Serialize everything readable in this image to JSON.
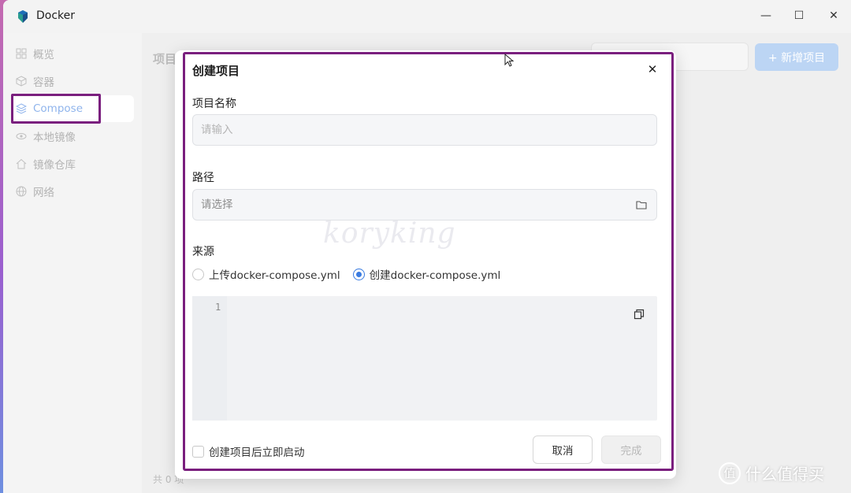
{
  "window": {
    "title": "Docker",
    "controls": {
      "minimize": "—",
      "maximize": "☐",
      "close": "✕"
    }
  },
  "sidebar": {
    "items": [
      {
        "label": "概览",
        "icon": "grid-icon"
      },
      {
        "label": "容器",
        "icon": "cube-icon"
      },
      {
        "label": "Compose",
        "icon": "layers-icon",
        "active": true
      },
      {
        "label": "本地镜像",
        "icon": "eye-icon"
      },
      {
        "label": "镜像仓库",
        "icon": "house-icon"
      },
      {
        "label": "网络",
        "icon": "globe-icon"
      }
    ]
  },
  "main": {
    "title": "项目",
    "new_button_label": "+ 新增项目",
    "total": "共 0 项"
  },
  "dialog": {
    "title": "创建项目",
    "close": "✕",
    "name_label": "项目名称",
    "name_placeholder": "请输入",
    "path_label": "路径",
    "path_placeholder": "请选择",
    "source_label": "来源",
    "source_options": [
      {
        "label": "上传docker-compose.yml",
        "selected": false
      },
      {
        "label": "创建docker-compose.yml",
        "selected": true
      }
    ],
    "editor_line_number": "1",
    "autostart_label": "创建项目后立即启动",
    "autostart_checked": false,
    "cancel_label": "取消",
    "done_label": "完成"
  },
  "watermarks": {
    "center": "koryking",
    "corner_badge": "值",
    "corner_text": "什么值得买"
  },
  "colors": {
    "accent": "#3a7be0",
    "highlight_frame": "#7a1f7e",
    "active_nav_text": "#8fb4ec",
    "new_button_bg": "#bcd5f4"
  }
}
